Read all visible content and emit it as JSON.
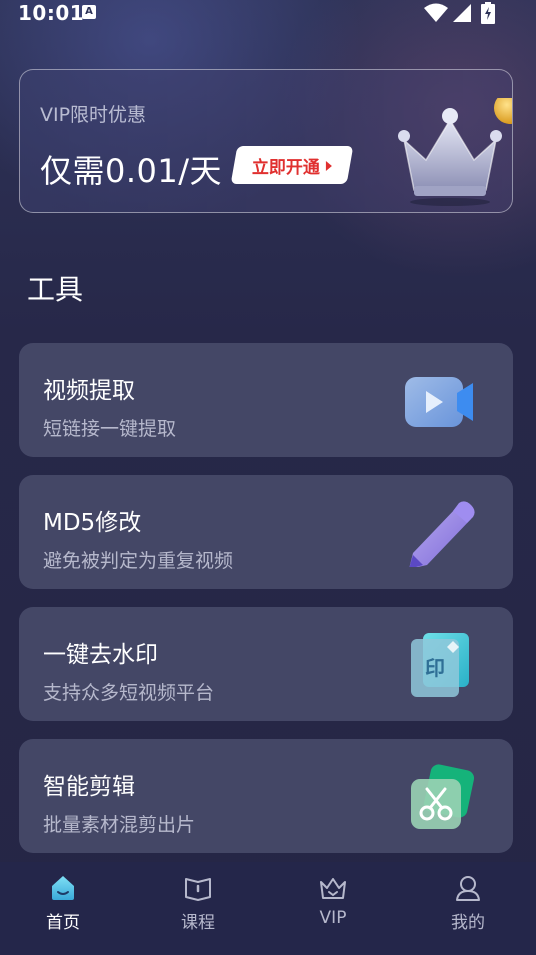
{
  "status_bar": {
    "time": "10:01",
    "app_icon_letter": "A"
  },
  "vip_banner": {
    "subtitle": "VIP限时优惠",
    "price": "仅需0.01/天",
    "cta_label": "立即开通"
  },
  "section": {
    "title": "工具"
  },
  "tools": [
    {
      "title": "视频提取",
      "desc": "短链接一键提取",
      "icon": "video-camera-icon"
    },
    {
      "title": "MD5修改",
      "desc": "避免被判定为重复视频",
      "icon": "pencil-icon"
    },
    {
      "title": "一键去水印",
      "desc": "支持众多短视频平台",
      "icon": "stamp-icon",
      "icon_text": "印"
    },
    {
      "title": "智能剪辑",
      "desc": "批量素材混剪出片",
      "icon": "scissors-icon"
    }
  ],
  "bottom_nav": [
    {
      "label": "首页",
      "icon": "home-icon",
      "active": true
    },
    {
      "label": "课程",
      "icon": "book-icon",
      "active": false
    },
    {
      "label": "VIP",
      "icon": "crown-icon",
      "active": false
    },
    {
      "label": "我的",
      "icon": "user-icon",
      "active": false
    }
  ],
  "colors": {
    "background": "#252645",
    "card": "#444766",
    "cta_text": "#e0302f",
    "accent_cyan": "#4fc3e8"
  }
}
